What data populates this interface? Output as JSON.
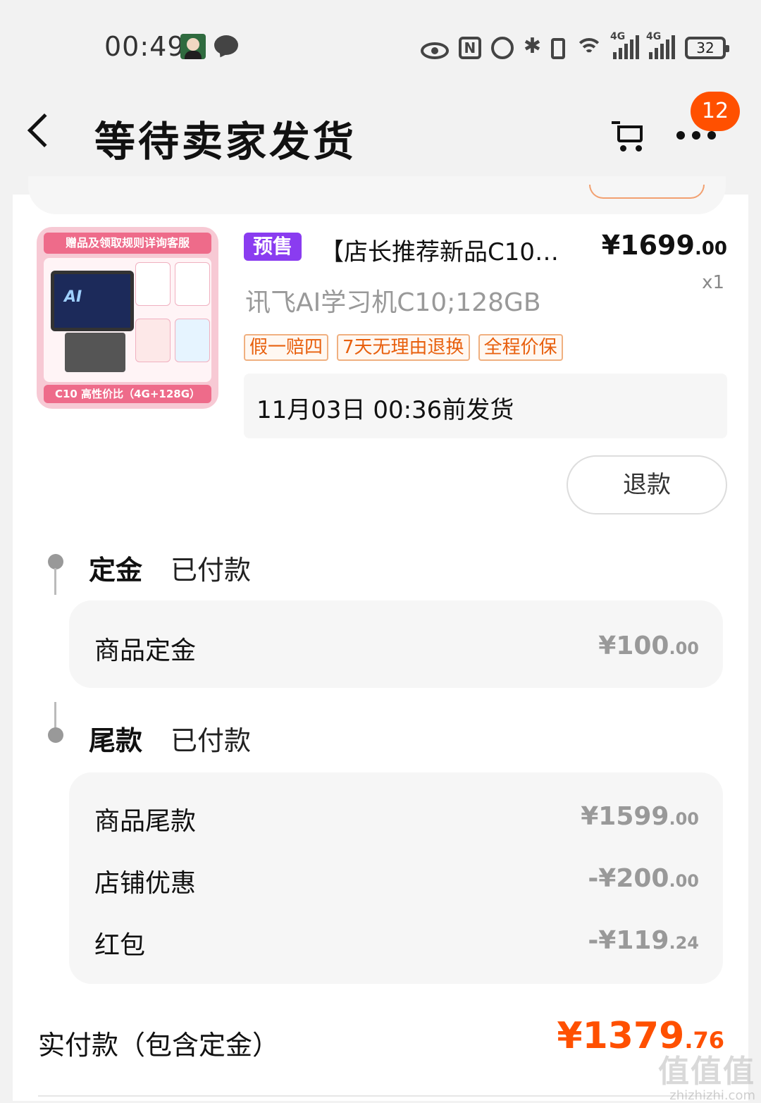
{
  "status_bar": {
    "time": "00:49",
    "net_tag_1": "4G",
    "net_tag_2": "4G",
    "battery": "32",
    "icons": [
      "avatar-icon",
      "chat-icon",
      "eye-icon",
      "nfc-icon",
      "alarm-icon",
      "bluetooth-icon",
      "vibrate-icon",
      "wifi-icon",
      "signal-icon",
      "battery-icon"
    ]
  },
  "header": {
    "title": "等待卖家发货",
    "cart_badge": "12",
    "icons": [
      "back-icon",
      "cart-icon",
      "more-icon"
    ]
  },
  "product": {
    "thumb_banner": "赠品及领取规则详询客服",
    "thumb_screen": "AI",
    "thumb_footer": "C10 高性价比（4G+128G）",
    "presale_tag": "预售",
    "title": "【店长推荐新品C10…",
    "price_int": "¥1699",
    "price_dec": ".00",
    "qty": "x1",
    "spec": "讯飞AI学习机C10;128GB",
    "service_tags": [
      "假一赔四",
      "7天无理由退换",
      "全程价保"
    ],
    "ship_notice": "11月03日 00:36前发货",
    "refund_label": "退款"
  },
  "deposit": {
    "title": "定金",
    "status": "已付款",
    "rows": [
      {
        "label": "商品定金",
        "value_int": "¥100",
        "value_dec": ".00"
      }
    ]
  },
  "balance": {
    "title": "尾款",
    "status": "已付款",
    "rows": [
      {
        "label": "商品尾款",
        "value_int": "¥1599",
        "value_dec": ".00"
      },
      {
        "label": "店铺优惠",
        "value_int": "-¥200",
        "value_dec": ".00"
      },
      {
        "label": "红包",
        "value_int": "-¥119",
        "value_dec": ".24"
      }
    ]
  },
  "total": {
    "label": "实付款（包含定金）",
    "value_int": "¥1379",
    "value_dec": ".76"
  },
  "watermark": {
    "logo": "值值值",
    "text": "zhizhizhi.com"
  },
  "colors": {
    "accent": "#ff5000",
    "presale": "#8a3cf0",
    "service_tag": "#e8600e",
    "background": "#f2f2f2"
  }
}
